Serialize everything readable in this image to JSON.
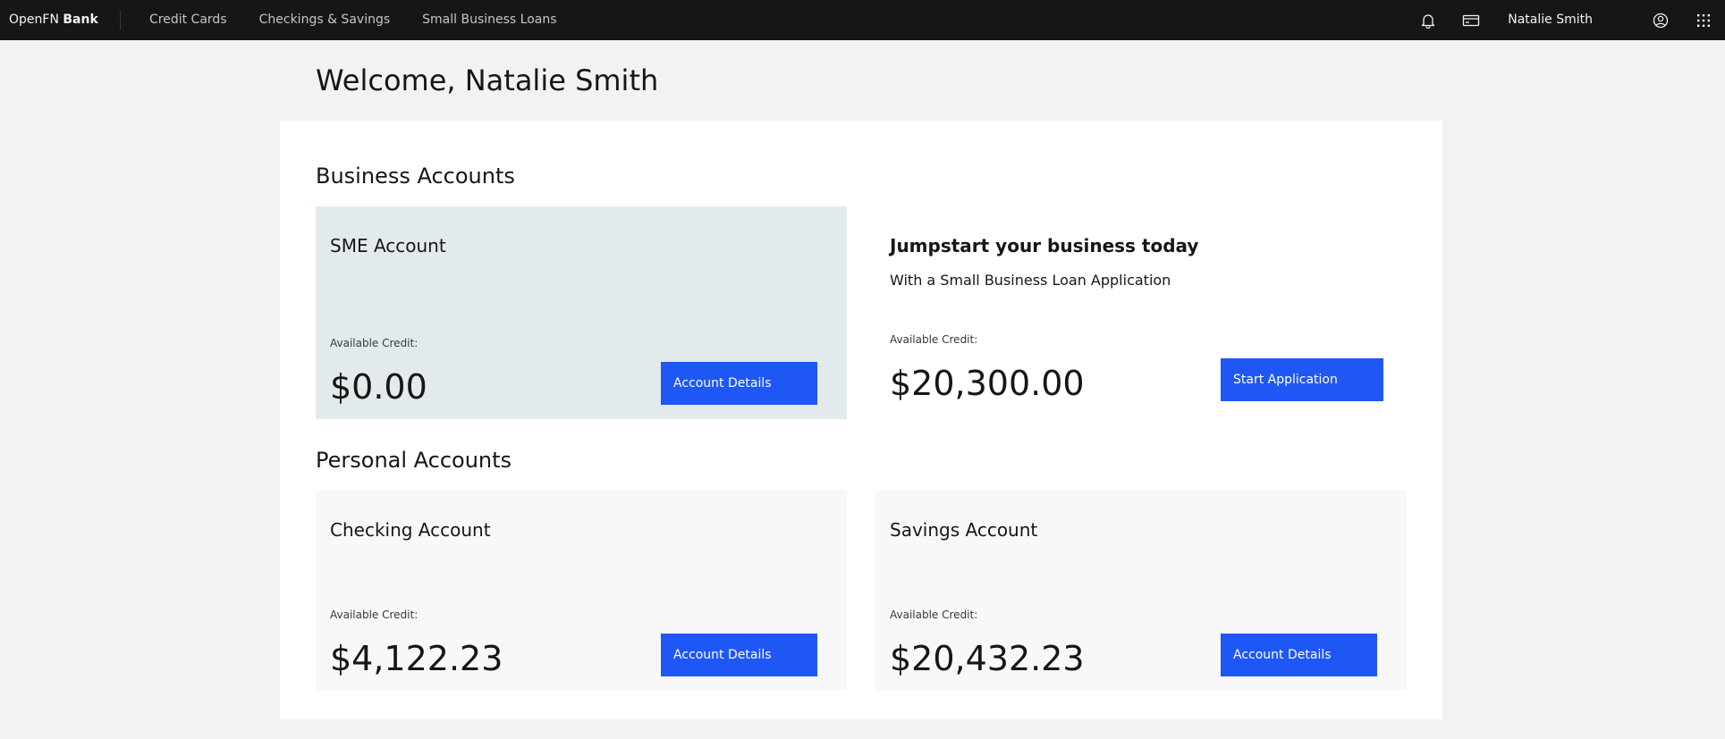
{
  "brand": {
    "prefix": "OpenFN",
    "strong": "Bank"
  },
  "nav": {
    "items": [
      {
        "label": "Credit Cards"
      },
      {
        "label": "Checkings & Savings"
      },
      {
        "label": "Small Business Loans"
      }
    ]
  },
  "header": {
    "notifications_icon": "bell-icon",
    "card_icon": "credit-card-icon",
    "user_name": "Natalie Smith",
    "profile_icon": "user-avatar-icon",
    "apps_icon": "app-switcher-icon"
  },
  "page": {
    "title": "Welcome, Natalie Smith"
  },
  "business": {
    "section_title": "Business Accounts",
    "sme": {
      "title": "SME Account",
      "label": "Available Credit:",
      "amount": "$0.00",
      "button": "Account Details"
    },
    "promo": {
      "heading": "Jumpstart your business today",
      "subheading": "With a Small Business Loan Application",
      "label": "Available Credit:",
      "amount": "$20,300.00",
      "button": "Start Application"
    }
  },
  "personal": {
    "section_title": "Personal Accounts",
    "checking": {
      "title": "Checking Account",
      "label": "Available Credit:",
      "amount": "$4,122.23",
      "button": "Account Details"
    },
    "savings": {
      "title": "Savings Account",
      "label": "Available Credit:",
      "amount": "$20,432.23",
      "button": "Account Details"
    }
  },
  "colors": {
    "topbar": "#161616",
    "accent_button": "#1f57f5",
    "sme_card": "#e2eaec",
    "personal_card": "#f8f7fa",
    "page_background": "#f2f2f2"
  }
}
